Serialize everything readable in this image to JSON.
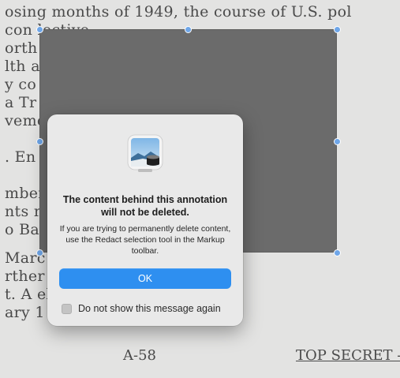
{
  "document": {
    "lines": [
      "osing months of 1949, the course of U.S. pol",
      " con                                 lective",
      "orth                                 r Euro",
      "lth                                  ally if",
      "y co                                 953, th",
      "a Tr                                 e progr",
      "veme",
      "",
      ". En",
      "",
      "mber                                  ten se",
      "nts                                   nal adm",
      "o Ba                                  rdance",
      "Marc                       1950, Mao's legi",
      "rther                     Vietnam was movin",
      "t.  A                     elegram reviewed",
      "ary 1"
    ],
    "footer_left": "A-58",
    "footer_right": "TOP SECRET -"
  },
  "dialog": {
    "icon": "preview-app-icon",
    "title": "The content behind this annotation will not be deleted.",
    "message": "If you are trying to permanently delete content, use the Redact selection tool in the Markup toolbar.",
    "ok_label": "OK",
    "checkbox_label": "Do not show this message again",
    "checkbox_checked": false
  },
  "colors": {
    "accent": "#2e8ff0",
    "annotation_fill": "#6b6b6b",
    "handle": "#6fa6e8"
  }
}
